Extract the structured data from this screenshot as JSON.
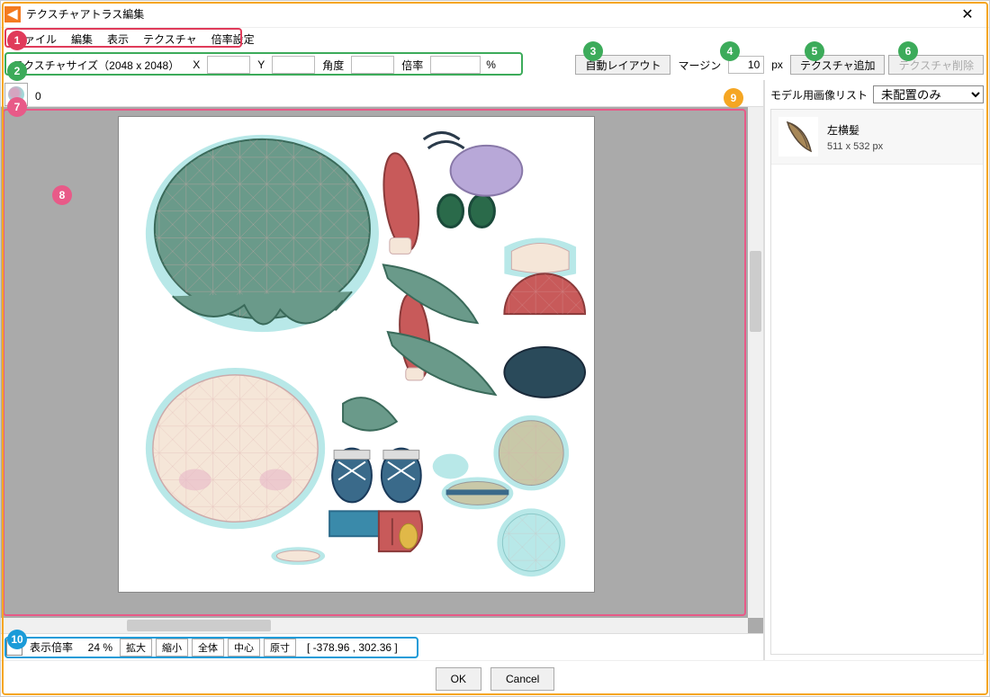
{
  "window": {
    "title": "テクスチャアトラス編集"
  },
  "menu": {
    "file": "ファイル",
    "edit": "編集",
    "view": "表示",
    "texture": "テクスチャ",
    "scale": "倍率設定"
  },
  "toolbar": {
    "texture_size_label": "テクスチャサイズ（2048 x 2048）",
    "x_label": "X",
    "y_label": "Y",
    "angle_label": "角度",
    "scale_label": "倍率",
    "percent": "%",
    "auto_layout": "自動レイアウト",
    "margin_label": "マージン",
    "margin_value": "10",
    "px": "px",
    "add_texture": "テクスチャ追加",
    "delete_texture": "テクスチャ削除",
    "x_value": "",
    "y_value": "",
    "angle_value": "",
    "scale_value": ""
  },
  "tabs": {
    "tab0": "0"
  },
  "status": {
    "zoom_label": "表示倍率",
    "zoom_value": "24 %",
    "zoom_in": "拡大",
    "zoom_out": "縮小",
    "fit": "全体",
    "center": "中心",
    "actual": "原寸",
    "coords": "[ -378.96 ,  302.36 ]"
  },
  "right": {
    "list_label": "モデル用画像リスト",
    "filter_selected": "未配置のみ",
    "items": [
      {
        "name": "左横髪",
        "dim": "511 x 532 px"
      }
    ]
  },
  "footer": {
    "ok": "OK",
    "cancel": "Cancel"
  },
  "annotations": {
    "a1": "1",
    "a2": "2",
    "a3": "3",
    "a4": "4",
    "a5": "5",
    "a6": "6",
    "a7": "7",
    "a8": "8",
    "a9": "9",
    "a10": "10"
  }
}
